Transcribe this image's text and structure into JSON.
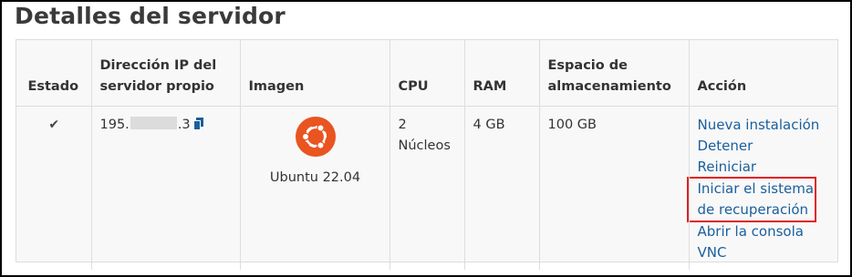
{
  "title": "Detalles del servidor",
  "table": {
    "headers": {
      "status": "Estado",
      "ip": "Dirección IP del servidor propio",
      "image": "Imagen",
      "cpu": "CPU",
      "ram": "RAM",
      "storage": "Espacio de almacenamiento",
      "action": "Acción"
    },
    "row": {
      "status_glyph": "✔",
      "ip_prefix": "195.",
      "ip_suffix": ".3",
      "image_name": "Ubuntu 22.04",
      "cpu": "2 Núcleos",
      "ram": "4 GB",
      "storage": "100 GB",
      "actions": {
        "reinstall": "Nueva instalación",
        "stop": "Detener",
        "restart": "Reiniciar",
        "rescue": "Iniciar el sistema de recuperación",
        "vnc": "Abrir la consola VNC"
      }
    }
  },
  "colors": {
    "link": "#1a5f9c",
    "highlight_border": "#e02020",
    "ubuntu_orange": "#e95420"
  },
  "icons": [
    "check-icon",
    "copy-icon",
    "ubuntu-logo-icon"
  ]
}
